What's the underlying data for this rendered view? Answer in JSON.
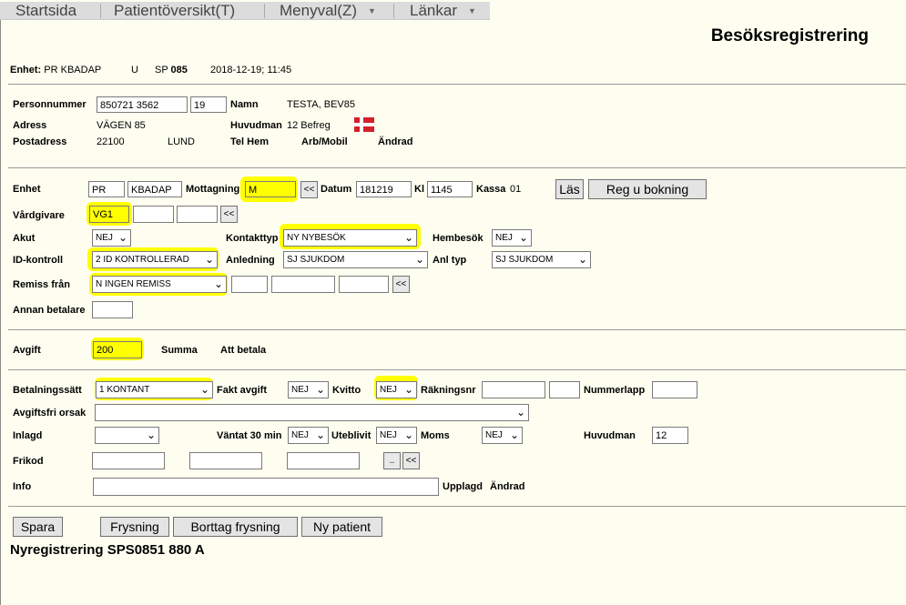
{
  "menu": {
    "items": [
      {
        "label": "Startsida"
      },
      {
        "label": "Patientöversikt(T)"
      },
      {
        "label": "Menyval(Z)"
      },
      {
        "label": "Länkar"
      }
    ]
  },
  "page_title": "Besöksregistrering",
  "unit_line": {
    "enhet_label": "Enhet:",
    "enhet_value": "PR KBADAP",
    "u": "U",
    "sp_label": "SP",
    "sp_value": "085",
    "datetime": "2018-12-19; 11:45"
  },
  "patient": {
    "personnummer_label": "Personnummer",
    "personnummer_value": "850721 3562",
    "personnummer_suffix": "19",
    "namn_label": "Namn",
    "namn_value": "TESTA, BEV85",
    "adress_label": "Adress",
    "adress_value": "VÄGEN 85",
    "huvudman_label": "Huvudman",
    "huvudman_value": "12 Befreg",
    "postadress_label": "Postadress",
    "postnr": "22100",
    "ort": "LUND",
    "telhem_label": "Tel Hem",
    "arbmobil_label": "Arb/Mobil",
    "andrad_label": "Ändrad"
  },
  "visit": {
    "enhet_label": "Enhet",
    "enhet_code": "PR",
    "enhet_name": "KBADAP",
    "mottagning_label": "Mottagning",
    "mottagning_value": "M",
    "datum_label": "Datum",
    "datum_value": "181219",
    "kl_label": "Kl",
    "kl_value": "1145",
    "kassa_label": "Kassa",
    "kassa_value": "01",
    "las_button": "Läs",
    "reg_button": "Reg u bokning",
    "vardgivare_label": "Vårdgivare",
    "vardgivare_value": "VG1",
    "akut_label": "Akut",
    "akut_value": "NEJ",
    "kontakttyp_label": "Kontakttyp",
    "kontakttyp_value": "NY NYBESÖK",
    "hembesok_label": "Hembesök",
    "hembesok_value": "NEJ",
    "idkontroll_label": "ID-kontroll",
    "idkontroll_value": "2 ID KONTROLLERAD",
    "anledning_label": "Anledning",
    "anledning_value": "SJ SJUKDOM",
    "anltyp_label": "Anl typ",
    "anltyp_value": "SJ SJUKDOM",
    "remiss_label": "Remiss från",
    "remiss_value": "N INGEN REMISS",
    "annan_betalare_label": "Annan betalare",
    "back_button": "<<"
  },
  "fee": {
    "avgift_label": "Avgift",
    "avgift_value": "200",
    "summa_label": "Summa",
    "att_betala_label": "Att betala"
  },
  "payment": {
    "betalningssatt_label": "Betalningssätt",
    "betalningssatt_value": "1 KONTANT",
    "fakt_avgift_label": "Fakt avgift",
    "fakt_avgift_value": "NEJ",
    "kvitto_label": "Kvitto",
    "kvitto_value": "NEJ",
    "rakningsnr_label": "Räkningsnr",
    "nummerlapp_label": "Nummerlapp",
    "avgiftsfri_label": "Avgiftsfri orsak",
    "inlagd_label": "Inlagd",
    "vantat_label": "Väntat 30 min",
    "vantat_value": "NEJ",
    "uteblivit_label": "Uteblivit",
    "uteblivit_value": "NEJ",
    "moms_label": "Moms",
    "moms_value": "NEJ",
    "huvudman_label": "Huvudman",
    "huvudman_value": "12",
    "frikod_label": "Frikod",
    "dots_button": "..",
    "info_label": "Info",
    "upplagd_label": "Upplagd",
    "andrad_label": "Ändrad"
  },
  "actions": {
    "spara": "Spara",
    "frysning": "Frysning",
    "borttag_frysning": "Borttag frysning",
    "ny_patient": "Ny patient"
  },
  "footer_text": "Nyregistrering SPS0851 880 A",
  "colors": {
    "highlight": "#ffff00",
    "background": "#fefef0",
    "menu": "#dcdcdc",
    "flag": "#d4202a"
  }
}
